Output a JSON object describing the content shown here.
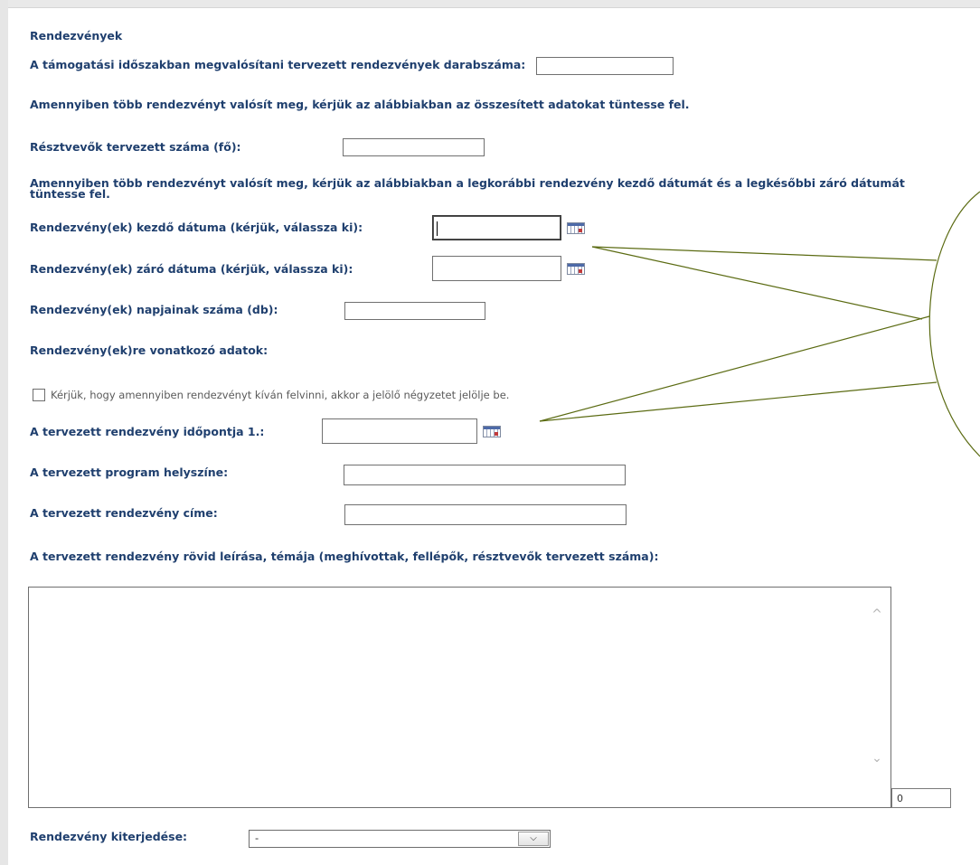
{
  "section": {
    "title": "Rendezvények"
  },
  "fields": {
    "event_count_label": "A támogatási időszakban megvalósítani tervezett rendezvények darabszáma:",
    "aggregate_note": "Amennyiben több rendezvényt valósít meg, kérjük az alábbiakban az összesített adatokat tüntesse fel.",
    "participants_label": "Résztvevők tervezett száma (fő):",
    "dates_note": "Amennyiben több rendezvényt valósít meg, kérjük az alábbiakban a legkorábbi rendezvény kezdő dátumát és a legkésőbbi záró dátumát tüntesse fel.",
    "start_date_label": "Rendezvény(ek) kezdő dátuma (kérjük, válassza ki):",
    "end_date_label": "Rendezvény(ek) záró dátuma (kérjük, válassza ki):",
    "days_label": "Rendezvény(ek) napjainak száma (db):",
    "event_data_label": "Rendezvény(ek)re vonatkozó adatok:",
    "checkbox_text": "Kérjük, hogy amennyiben rendezvényt kíván felvinni, akkor a jelölő négyzetet jelölje be.",
    "planned_date_label": "A tervezett rendezvény időpontja 1.:",
    "venue_label": "A tervezett program helyszíne:",
    "event_title_label": "A tervezett rendezvény címe:",
    "description_label": "A tervezett rendezvény rövid leírása, témája (meghívottak, fellépők, résztvevők tervezett száma):",
    "char_counter": "0",
    "scope_label": "Rendezvény kiterjedése:",
    "scope_selected": "-"
  },
  "icons": {
    "calendar": "calendar-icon",
    "select_arrow": "⌵",
    "scroll_up": "^",
    "scroll_down": "⌄"
  },
  "colors": {
    "label": "#1f3f6e",
    "annotation": "#5b6b12"
  }
}
